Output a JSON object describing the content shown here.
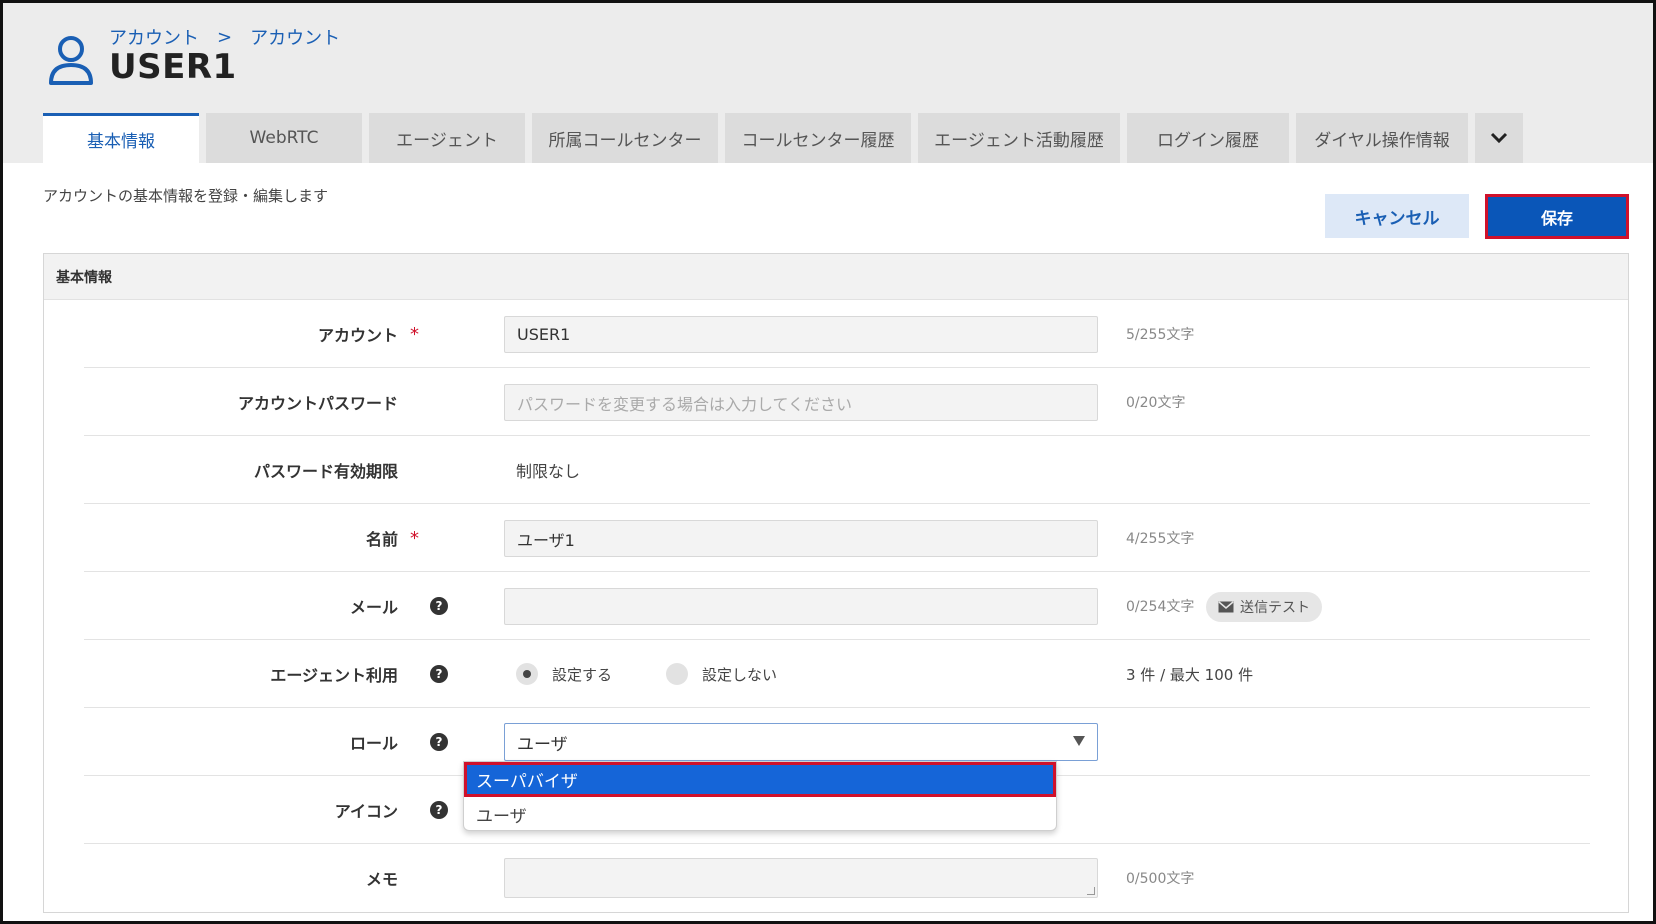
{
  "breadcrumb": {
    "item1": "アカウント",
    "sep": ">",
    "item2": "アカウント"
  },
  "page_title": "USER1",
  "tabs": [
    {
      "label": "基本情報"
    },
    {
      "label": "WebRTC"
    },
    {
      "label": "エージェント"
    },
    {
      "label": "所属コールセンター"
    },
    {
      "label": "コールセンター履歴"
    },
    {
      "label": "エージェント活動履歴"
    },
    {
      "label": "ログイン履歴"
    },
    {
      "label": "ダイヤル操作情報"
    }
  ],
  "description": "アカウントの基本情報を登録・編集します",
  "buttons": {
    "cancel": "キャンセル",
    "save": "保存"
  },
  "panel_title": "基本情報",
  "required_mark": "*",
  "help_mark": "?",
  "fields": {
    "account": {
      "label": "アカウント",
      "value": "USER1",
      "counter": "5/255文字"
    },
    "password": {
      "label": "アカウントパスワード",
      "placeholder": "パスワードを変更する場合は入力してください",
      "counter": "0/20文字"
    },
    "expiry": {
      "label": "パスワード有効期限",
      "value": "制限なし"
    },
    "name": {
      "label": "名前",
      "value": "ユーザ1",
      "counter": "4/255文字"
    },
    "mail": {
      "label": "メール",
      "value": "",
      "counter": "0/254文字",
      "send_test": "送信テスト"
    },
    "agent": {
      "label": "エージェント利用",
      "opt_on": "設定する",
      "opt_off": "設定しない",
      "limit": "3 件 / 最大 100 件"
    },
    "role": {
      "label": "ロール",
      "value": "ユーザ",
      "options": [
        "スーパバイザ",
        "ユーザ"
      ]
    },
    "icon": {
      "label": "アイコン"
    },
    "memo": {
      "label": "メモ",
      "counter": "0/500文字"
    }
  },
  "colors": {
    "accent": "#1a5fb4",
    "save_bg": "#0a56b8",
    "highlight_border": "#d0112b",
    "dropdown_selected": "#1565d8"
  }
}
